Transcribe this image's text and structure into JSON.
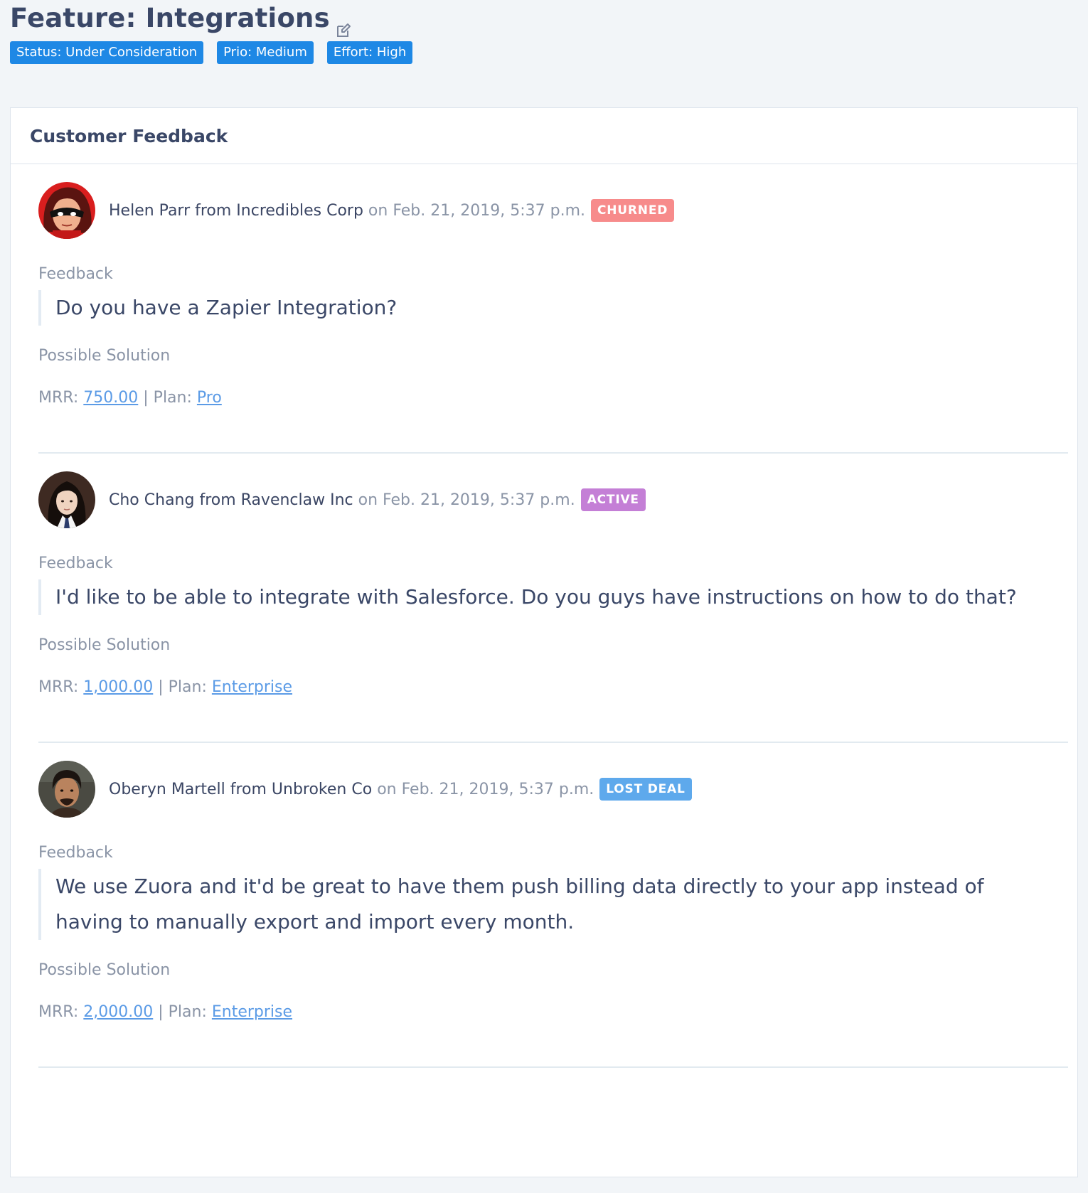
{
  "feature": {
    "title": "Feature: Integrations",
    "edit_icon": "edit-icon",
    "tags": [
      {
        "label": "Status: Under Consideration"
      },
      {
        "label": "Prio: Medium"
      },
      {
        "label": "Effort: High"
      }
    ],
    "tag_color": "#1e88e5"
  },
  "card": {
    "title": "Customer Feedback"
  },
  "labels": {
    "feedback": "Feedback",
    "possible_solution": "Possible Solution",
    "mrr": "MRR: ",
    "plan_sep": " | Plan: "
  },
  "feedback": [
    {
      "customer": "Helen Parr from Incredibles Corp",
      "date": "on Feb. 21, 2019, 5:37 p.m.",
      "badge": "CHURNED",
      "badge_color": "#f78b8b",
      "text": "Do you have a Zapier Integration?",
      "mrr": "750.00",
      "plan": "Pro"
    },
    {
      "customer": "Cho Chang from Ravenclaw Inc",
      "date": "on Feb. 21, 2019, 5:37 p.m.",
      "badge": "ACTIVE",
      "badge_color": "#c47fd6",
      "text": "I'd like to be able to integrate with Salesforce. Do you guys have instructions on how to do that?",
      "mrr": "1,000.00",
      "plan": "Enterprise"
    },
    {
      "customer": "Oberyn Martell from Unbroken Co",
      "date": "on Feb. 21, 2019, 5:37 p.m.",
      "badge": "LOST DEAL",
      "badge_color": "#5ea9ec",
      "text": "We use Zuora and it'd be great to have them push billing data directly to your app instead of having to manually export and import every month.",
      "mrr": "2,000.00",
      "plan": "Enterprise"
    }
  ]
}
